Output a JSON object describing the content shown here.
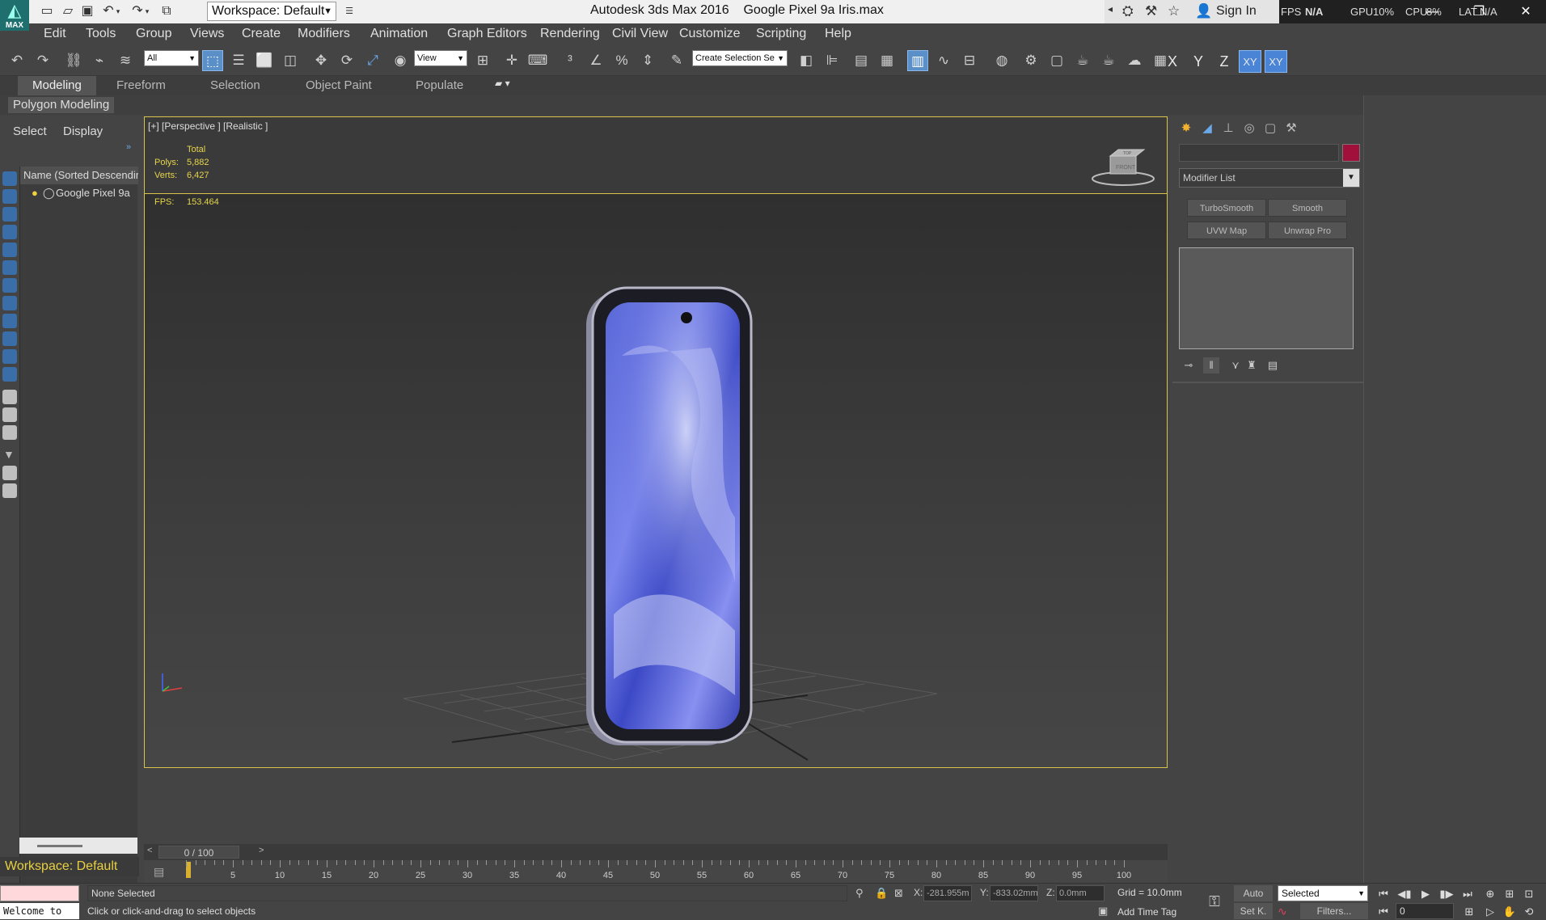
{
  "app": {
    "logo_label": "MAX",
    "title": "Autodesk 3ds Max 2016",
    "file": "Google Pixel 9a Iris.max",
    "workspace": "Workspace: Default",
    "sign_in": "Sign In",
    "stats": {
      "fps": "FPS",
      "fps_val": "N/A",
      "gpu": "GPU",
      "gpu_val": "10%",
      "cpu": "CPU",
      "cpu_val": "8%",
      "lat": "LAT",
      "lat_val": "N/A"
    }
  },
  "menu": [
    "Edit",
    "Tools",
    "Group",
    "Views",
    "Create",
    "Modifiers",
    "Animation",
    "Graph Editors",
    "Rendering",
    "Civil View",
    "Customize",
    "Scripting",
    "Help"
  ],
  "toolbar": {
    "filter": "All",
    "ref_coord": "View",
    "named_selection": "Create Selection Se",
    "axes": [
      "X",
      "Y",
      "Z",
      "XY",
      "XY"
    ]
  },
  "ribbon": {
    "tabs": [
      "Modeling",
      "Freeform",
      "Selection",
      "Object Paint",
      "Populate"
    ],
    "sub": "Polygon Modeling"
  },
  "explorer": {
    "tabs": [
      "Select",
      "Display"
    ],
    "header": "Name (Sorted Descendir",
    "rows": [
      "Google Pixel 9a"
    ],
    "workspace": "Workspace: Default"
  },
  "viewport": {
    "label": "[+] [Perspective ] [Realistic ]",
    "stats": {
      "total": "Total",
      "polys_label": "Polys:",
      "polys": "5,882",
      "verts_label": "Verts:",
      "verts": "6,427"
    },
    "fps_label": "FPS:",
    "fps": "153.464",
    "viewcube_top": "TOP",
    "viewcube_front": "FRONT"
  },
  "timeline": {
    "slider": "0 / 100",
    "ticks": [
      "5",
      "10",
      "15",
      "20",
      "25",
      "30",
      "35",
      "40",
      "45",
      "50",
      "55",
      "60",
      "65",
      "70",
      "75",
      "80",
      "85",
      "90",
      "95",
      "100"
    ]
  },
  "command_panel": {
    "modifier_list": "Modifier List",
    "buttons": [
      "TurboSmooth",
      "Smooth",
      "UVW Map",
      "Unwrap Pro"
    ],
    "color": "#a0103a"
  },
  "status": {
    "welcome": "Welcome to",
    "selection": "None Selected",
    "prompt": "Click or click-and-drag to select objects",
    "x_label": "X:",
    "x": "-281.955m",
    "y_label": "Y:",
    "y": "-833.02mm",
    "z_label": "Z:",
    "z": "0.0mm",
    "grid": "Grid = 10.0mm",
    "add_time_tag": "Add Time Tag",
    "auto": "Auto",
    "set_key": "Set K.",
    "key_filter": "Selected",
    "filters": "Filters...",
    "frame": "0"
  }
}
